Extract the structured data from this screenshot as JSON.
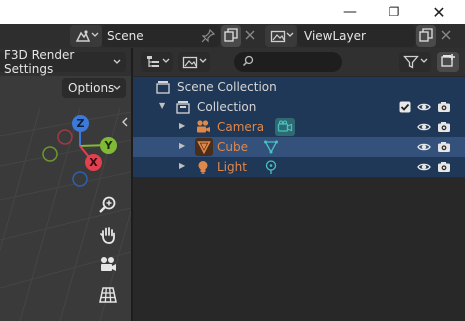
{
  "window": {
    "minimize_glyph": "—",
    "maximize_glyph": "❐",
    "close_glyph": "✕"
  },
  "topbar": {
    "scene_name": "Scene",
    "view_layer_name": "ViewLayer"
  },
  "viewport": {
    "render_settings_label": "F3D Render Settings",
    "options_label": "Options",
    "gizmo_labels": {
      "z": "Z",
      "y": "Y",
      "x": "X"
    },
    "tools": [
      "zoom-icon",
      "hand-icon",
      "camera-view-icon",
      "grid-icon"
    ]
  },
  "outliner": {
    "search_placeholder": "",
    "rows": [
      {
        "label": "Scene Collection",
        "color": "#d6d6d6"
      },
      {
        "label": "Collection",
        "color": "#d6d6d6"
      },
      {
        "label": "Camera",
        "color": "#e0874a"
      },
      {
        "label": "Cube",
        "color": "#e0874a"
      },
      {
        "label": "Light",
        "color": "#e0874a"
      }
    ]
  },
  "colors": {
    "object_orange": "#e0874a",
    "data_teal": "#46c2c2",
    "selection_blue": "#1f3857",
    "active_blue": "#33517a"
  }
}
